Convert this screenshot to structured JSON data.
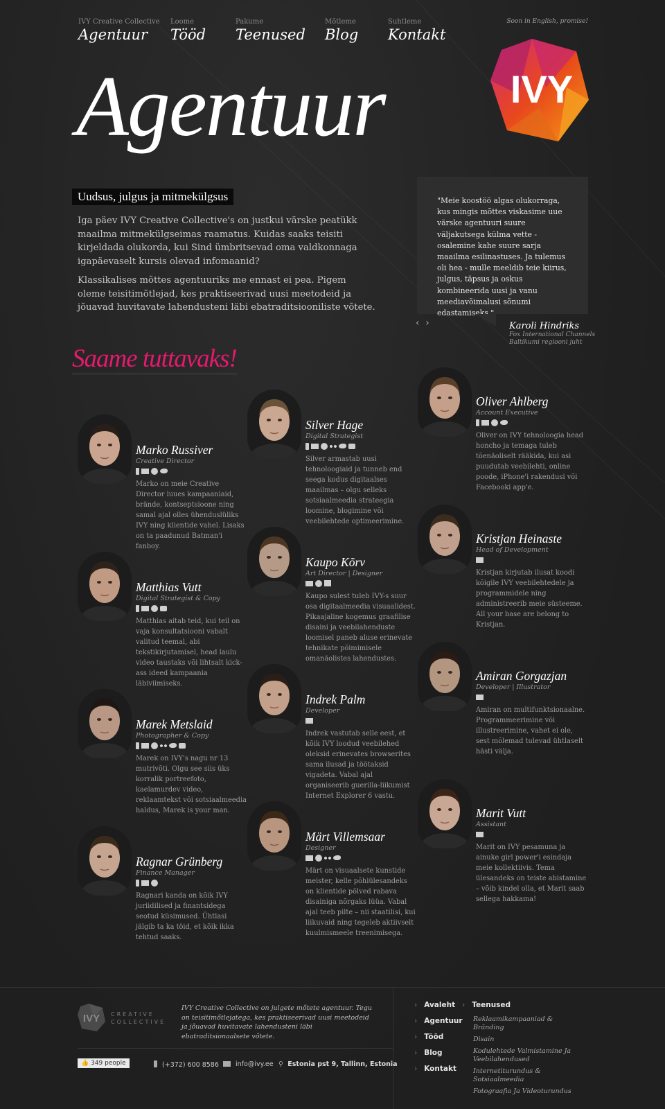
{
  "nav": [
    {
      "sub": "IVY Creative Collective",
      "label": "Agentuur"
    },
    {
      "sub": "Loome",
      "label": "Tööd"
    },
    {
      "sub": "Pakume",
      "label": "Teenused"
    },
    {
      "sub": "Mõtleme",
      "label": "Blog"
    },
    {
      "sub": "Suhtleme",
      "label": "Kontakt"
    }
  ],
  "lang_note": "Soon in English, promise!",
  "logo_text": "IVY",
  "hero": {
    "title": "Agentuur",
    "tagline": "Uudsus, julgus ja mitmekülgsus",
    "p1": "Iga päev IVY Creative Collective's on justkui värske peatükk maailma mitmekülgseimas raamatus. Kuidas saaks teisiti kirjeldada olukorda, kui Sind ümbritsevad oma valdkonnaga igapäevaselt kursis olevad infomaanid?",
    "p2": "Klassikalises mõttes agentuuriks me ennast ei pea. Pigem oleme teisitimõtlejad, kes praktiseerivad uusi meetodeid ja jõuavad huvitavate lahendusteni läbi ebatraditsiooniliste võtete."
  },
  "quote": {
    "text": "\"Meie koostöö algas olukorraga, kus mingis mõttes viskasime uue värske agentuuri suure väljakutsega külma vette - osalemine kahe suure sarja maailma esilinastuses. Ja tulemus oli hea - mulle meeldib teie kiirus, julgus, täpsus ja oskus kombineerida uusi ja vanu meediavõimalusi sõnumi edastamiseks.\"",
    "prev": "‹",
    "next": "›",
    "author": "Karoli Hindriks",
    "company": "Fox International Channels",
    "position": "Baltikumi regiooni juht"
  },
  "section_title": "Saame tuttavaks!",
  "team": [
    {
      "name": "Marko Russiver",
      "role": "Creative Director",
      "icons": [
        "phone-icon",
        "mail-icon",
        "skype-icon",
        "twitter-icon"
      ],
      "bio": "Marko on meie Creative Director luues kampaaniaid, brände, kontseptsioone ning samal ajal olles ühenduslüliks IVY ning klientide vahel. Lisaks on ta paadunud Batman'i fanboy."
    },
    {
      "name": "Matthias Vutt",
      "role": "Digital Strategist & Copy",
      "icons": [
        "phone-icon",
        "mail-icon",
        "skype-icon",
        "chat-icon"
      ],
      "bio": "Matthias aitab teid, kui teil on vaja konsultatsiooni vabalt valitud teemal, abi tekstikirjutamisel, head laulu video taustaks või lihtsalt kick-ass ideed kampaania läbiviimiseks."
    },
    {
      "name": "Marek Metslaid",
      "role": "Photographer & Copy",
      "icons": [
        "phone-icon",
        "mail-icon",
        "skype-icon",
        "flickr-icon",
        "twitter-icon",
        "chat-icon"
      ],
      "bio": "Marek on IVY's nagu nr 13 mutrivõti. Olgu see siis üks korralik portreefoto, kaelamurdev video, reklaamtekst või sotsiaalmeedia haldus, Marek is your man."
    },
    {
      "name": "Ragnar Grünberg",
      "role": "Finance Manager",
      "icons": [
        "phone-icon",
        "mail-icon",
        "skype-icon"
      ],
      "bio": "Ragnari kanda on kõik IVY juriidilised ja finantsidega seotud küsimused. Ühtlasi jälgib ta ka töid, et kõik ikka tehtud saaks."
    },
    {
      "name": "Silver Hage",
      "role": "Digital Strategist",
      "icons": [
        "phone-icon",
        "mail-icon",
        "skype-icon",
        "flickr-icon",
        "twitter-icon",
        "chat-icon"
      ],
      "bio": "Silver armastab uusi tehnoloogiaid ja tunneb end seega kodus digitaalses maailmas – olgu selleks sotsiaalmeedia strateegia loomine, blogimine või veebilehtede optimeerimine."
    },
    {
      "name": "Kaupo Kõrv",
      "role": "Art Director | Designer",
      "icons": [
        "mail-icon",
        "skype-icon",
        "bag-icon"
      ],
      "bio": "Kaupo sulest tuleb IVY-s suur osa digitaalmeedia visuaalidest. Pikaajaline kogemus graafilise disaini ja veebilahenduste loomisel paneb aluse erinevate tehnikate põimimisele omanäolistes lahendustes."
    },
    {
      "name": "Indrek Palm",
      "role": "Developer",
      "icons": [
        "mail-icon"
      ],
      "bio": "Indrek vastutab selle eest, et kõik IVY loodud veebilehed oleksid erinevates browserites sama ilusad ja töötaksid vigadeta. Vabal ajal organiseerib guerilla-liikumist Internet Explorer 6 vastu."
    },
    {
      "name": "Märt Villemsaar",
      "role": "Designer",
      "icons": [
        "mail-icon",
        "skype-icon",
        "flickr-icon",
        "twitter-icon"
      ],
      "bio": "Märt on visuaalsete kunstide meister, kelle põhiülesandeks on klientide põlved rabava disainiga nõrgaks lüüa. Vabal ajal teeb pilte – nii staatilisi, kui liikuvaid ning tegeleb aktiivselt kuulmismeele treenimisega."
    },
    {
      "name": "Oliver Ahlberg",
      "role": "Account Executive",
      "icons": [
        "phone-icon",
        "mail-icon",
        "skype-icon",
        "twitter-icon"
      ],
      "bio": "Oliver on IVY tehnoloogia head honcho ja temaga tuleb tõenäoliselt rääkida, kui asi puudutab veebilehti, online poode, iPhone'i rakendusi või Facebooki app'e."
    },
    {
      "name": "Kristjan Heinaste",
      "role": "Head of Development",
      "icons": [
        "mail-icon"
      ],
      "bio": "Kristjan kirjutab ilusat koodi kõigile IVY veebilehtedele ja programmidele ning administreerib meie süsteeme. All your base are belong to Kristjan."
    },
    {
      "name": "Amiran Gorgazjan",
      "role": "Developer | Illustrator",
      "icons": [
        "mail-icon"
      ],
      "bio": "Amiran on multifunktsionaalne. Programmeerimine või illustreerimine, vahet ei ole, sest mõlemad tulevad ühtlaselt hästi välja."
    },
    {
      "name": "Marit Vutt",
      "role": "Assistant",
      "icons": [
        "mail-icon"
      ],
      "bio": "Marit on IVY pesamuna ja ainuke girl power'i esindaja meie kollektiivis. Tema ülesandeks on teiste abistamine – võib kindel olla, et Marit saab sellega hakkama!"
    }
  ],
  "footer": {
    "logo_text": "IVY",
    "logo_sub_1": "CREATIVE",
    "logo_sub_2": "COLLECTIVE",
    "about": "IVY Creative Collective on julgete mõtete agentuur. Tegu on teisitimõtlejatega, kes praktiseerivad uusi meetodeid ja jõuavad huvitavate lahendusteni läbi ebatraditsionaalsete võtete.",
    "like": "349 people",
    "phone": "(+372) 600 8586",
    "email": "info@ivy.ee",
    "address": "Estonia pst 9, Tallinn, Estonia",
    "nav": [
      "Avaleht",
      "Agentuur",
      "Tööd",
      "Blog",
      "Kontakt"
    ],
    "services_title": "Teenused",
    "services": [
      "Reklaamikampaaniad & Bränding",
      "Disain",
      "Kodulehtede Valmistamine Ja Veebilahendused",
      "Internetiturundus & Sotsiaalmeedia",
      "Fotograafia Ja Videoturundus"
    ]
  }
}
